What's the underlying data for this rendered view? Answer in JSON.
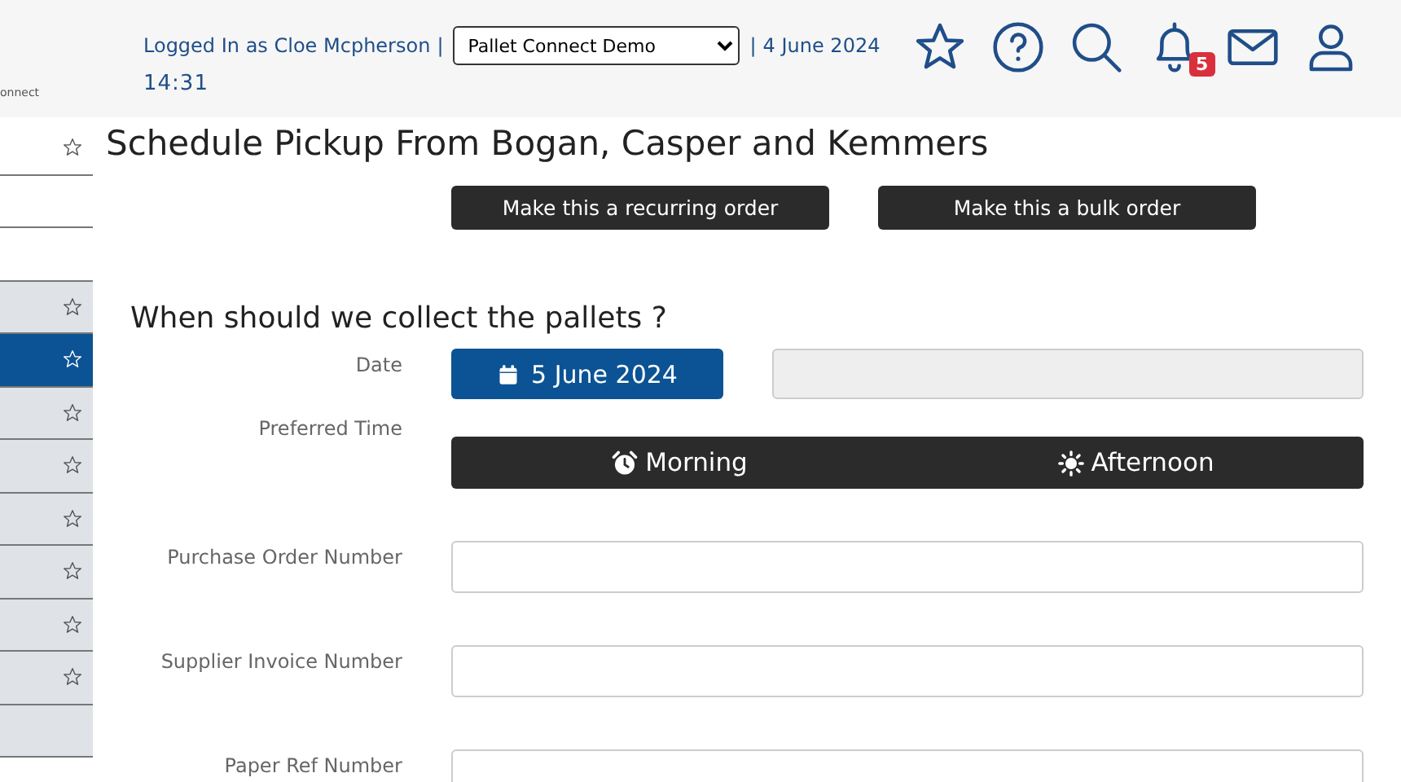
{
  "logo": {
    "text": "onnect"
  },
  "header": {
    "user": "Logged In as Cloe Mcpherson",
    "separator": "|",
    "account": "Pallet Connect Demo",
    "separator_2": "|",
    "date": "4 June 2024",
    "time": "14:31",
    "notifications": "5"
  },
  "sidebar": {
    "items": [
      {
        "kind": "star",
        "shaded": false,
        "selected": false
      },
      {
        "kind": "empty",
        "shaded": false,
        "selected": false
      },
      {
        "kind": "empty",
        "shaded": false,
        "selected": false
      },
      {
        "kind": "star",
        "shaded": true,
        "selected": false
      },
      {
        "kind": "star",
        "shaded": true,
        "selected": true
      },
      {
        "kind": "star",
        "shaded": true,
        "selected": false
      },
      {
        "kind": "star",
        "shaded": true,
        "selected": false
      },
      {
        "kind": "star",
        "shaded": true,
        "selected": false
      },
      {
        "kind": "star",
        "shaded": true,
        "selected": false
      },
      {
        "kind": "star",
        "shaded": true,
        "selected": false
      },
      {
        "kind": "star",
        "shaded": true,
        "selected": false
      },
      {
        "kind": "empty",
        "shaded": true,
        "selected": false
      }
    ]
  },
  "page": {
    "title": "Schedule Pickup From Bogan, Casper and Kemmers",
    "order_buttons": [
      "Make this a recurring order",
      "Make this a bulk order"
    ],
    "section_title": "When should we collect the pallets ?",
    "date": {
      "label": "Date",
      "value": "5 June 2024"
    },
    "preferred_time": {
      "label": "Preferred Time",
      "options": [
        {
          "kind": "morning",
          "label": "Morning",
          "selected": false
        },
        {
          "kind": "afternoon",
          "label": "Afternoon",
          "selected": false
        }
      ]
    },
    "fields": [
      {
        "label": "Purchase Order Number"
      },
      {
        "label": "Supplier Invoice Number"
      },
      {
        "label": "Paper Ref Number"
      }
    ]
  }
}
